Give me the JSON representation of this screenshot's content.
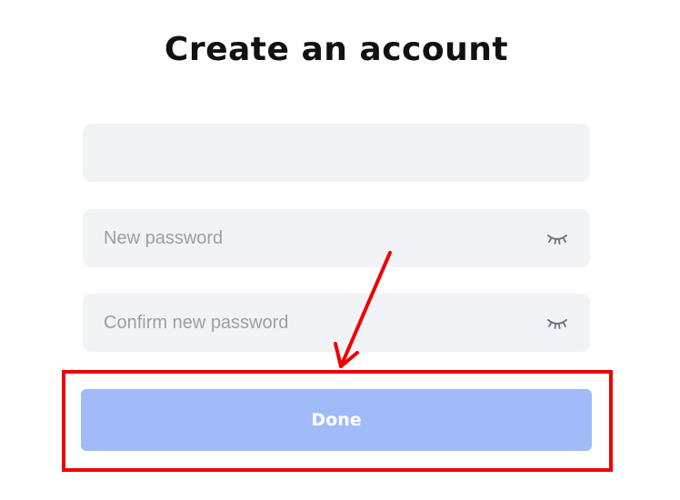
{
  "page": {
    "title": "Create an account"
  },
  "form": {
    "email": {
      "value": "",
      "placeholder": ""
    },
    "new_password": {
      "value": "",
      "placeholder": "New password",
      "toggle_icon": "eye-closed-icon"
    },
    "confirm_password": {
      "value": "",
      "placeholder": "Confirm new password",
      "toggle_icon": "eye-closed-icon"
    },
    "done_label": "Done"
  },
  "annotation": {
    "highlight_color": "#ee0000",
    "arrow_icon": "arrow-pointer-icon"
  },
  "colors": {
    "field_bg": "#f1f3f6",
    "button_bg": "#a1bbf8",
    "title_text": "#111111"
  }
}
